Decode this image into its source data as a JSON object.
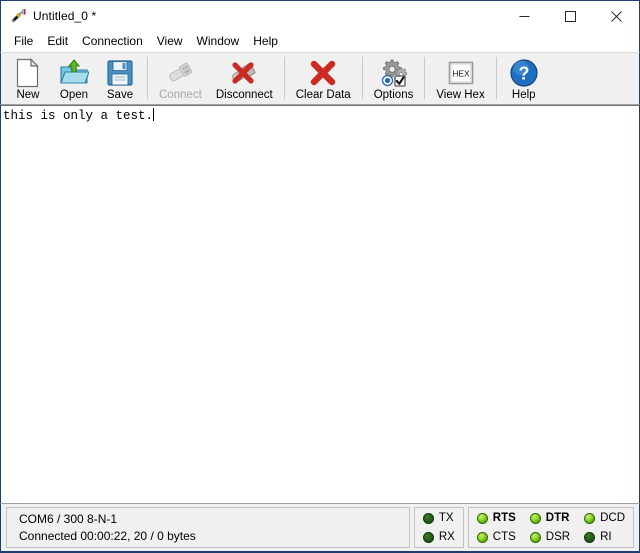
{
  "window": {
    "title": "Untitled_0 *",
    "icon": "serial-plug-icon",
    "controls": {
      "minimize": "minimize-button",
      "maximize": "maximize-button",
      "close": "close-button"
    }
  },
  "menu": {
    "items": [
      {
        "label": "File"
      },
      {
        "label": "Edit"
      },
      {
        "label": "Connection"
      },
      {
        "label": "View"
      },
      {
        "label": "Window"
      },
      {
        "label": "Help"
      }
    ]
  },
  "toolbar": {
    "groups": [
      {
        "buttons": [
          {
            "label": "New",
            "icon": "new-document-icon",
            "enabled": true
          },
          {
            "label": "Open",
            "icon": "open-folder-icon",
            "enabled": true
          },
          {
            "label": "Save",
            "icon": "save-floppy-icon",
            "enabled": true
          }
        ]
      },
      {
        "buttons": [
          {
            "label": "Connect",
            "icon": "connect-plug-icon",
            "enabled": false
          },
          {
            "label": "Disconnect",
            "icon": "disconnect-plug-icon",
            "enabled": true
          }
        ]
      },
      {
        "buttons": [
          {
            "label": "Clear Data",
            "icon": "clear-data-x-icon",
            "enabled": true
          }
        ]
      },
      {
        "buttons": [
          {
            "label": "Options",
            "icon": "options-gears-icon",
            "enabled": true
          }
        ]
      },
      {
        "buttons": [
          {
            "label": "View Hex",
            "icon": "view-hex-icon",
            "enabled": true
          }
        ]
      },
      {
        "buttons": [
          {
            "label": "Help",
            "icon": "help-question-icon",
            "enabled": true
          }
        ]
      }
    ]
  },
  "terminal": {
    "content": "this is only a test."
  },
  "status": {
    "port_line": "COM6 / 300 8-N-1",
    "connection_line": "Connected 00:00:22, 20 / 0 bytes",
    "data_leds": [
      {
        "label": "TX",
        "state": "off",
        "bold": false
      },
      {
        "label": "RX",
        "state": "off",
        "bold": false
      }
    ],
    "signal_leds": [
      {
        "label": "RTS",
        "state": "on",
        "bold": true
      },
      {
        "label": "CTS",
        "state": "on",
        "bold": false
      },
      {
        "label": "DTR",
        "state": "on",
        "bold": true
      },
      {
        "label": "DSR",
        "state": "on",
        "bold": false
      },
      {
        "label": "DCD",
        "state": "on",
        "bold": false
      },
      {
        "label": "RI",
        "state": "off",
        "bold": false
      }
    ]
  },
  "colors": {
    "led_on": "#8fd42a",
    "led_off": "#27611c",
    "window_border": "#1c3f6e",
    "chrome": "#f0f0f0"
  }
}
